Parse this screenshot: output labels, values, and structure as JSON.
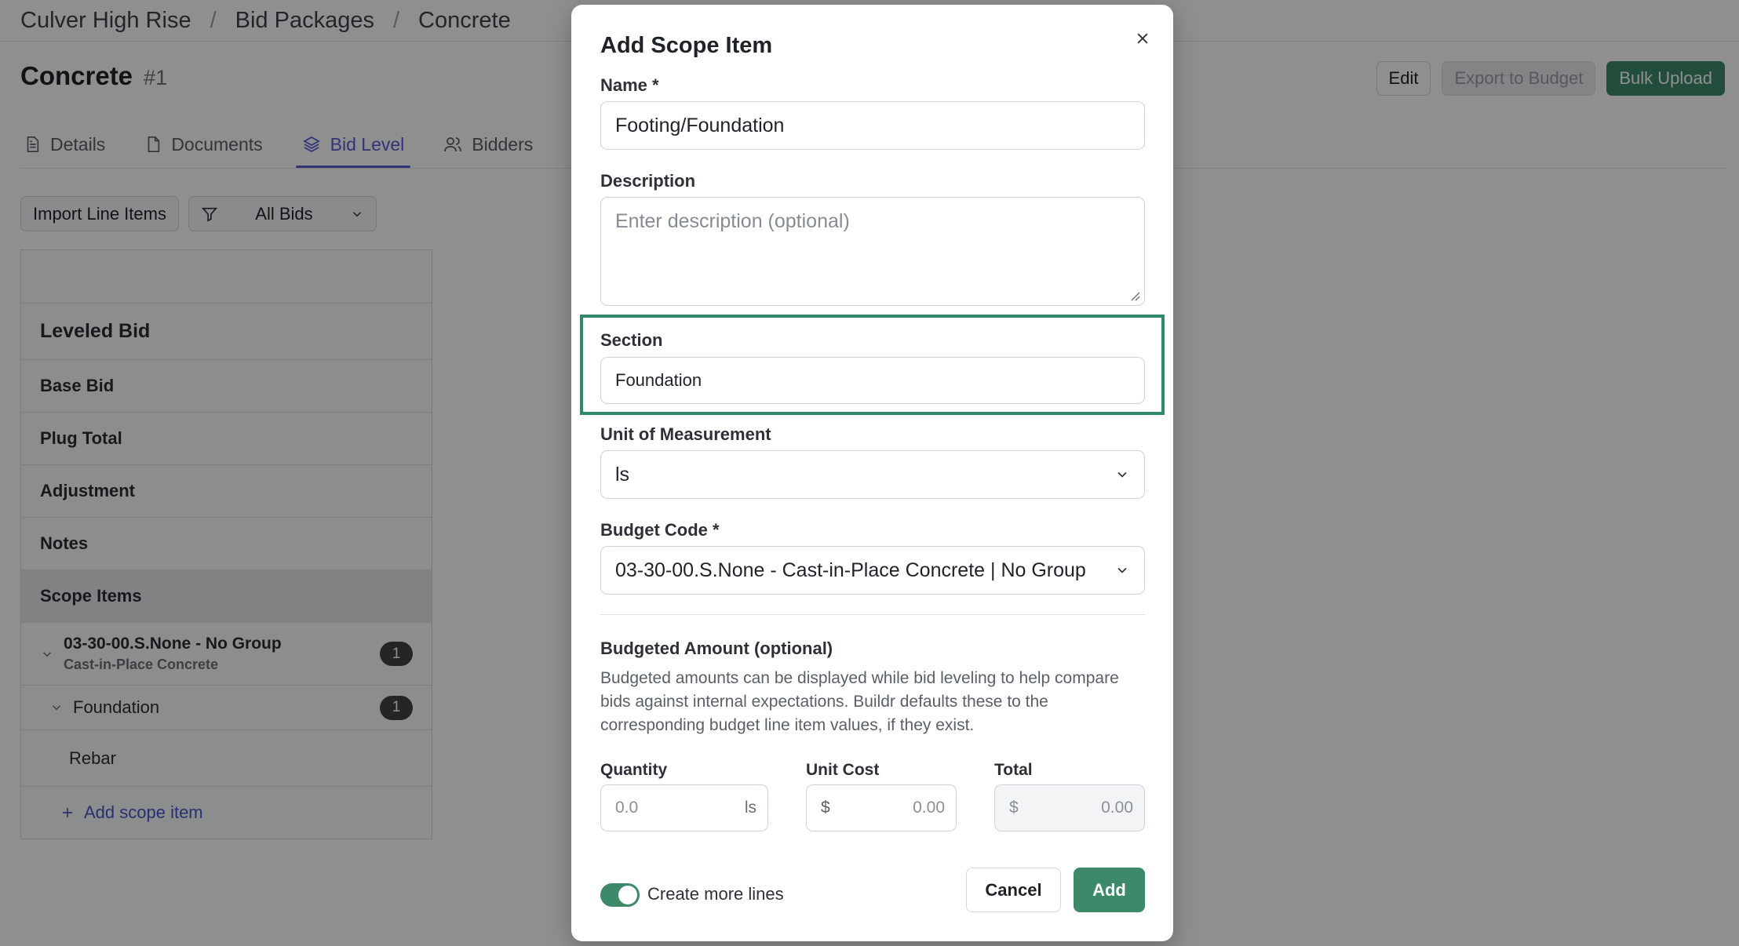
{
  "breadcrumb": {
    "items": [
      "Culver High Rise",
      "Bid Packages",
      "Concrete"
    ],
    "separator": "/"
  },
  "page": {
    "title": "Concrete",
    "number": "#1"
  },
  "actions": {
    "edit": "Edit",
    "export": "Export to Budget",
    "bulk_upload": "Bulk Upload"
  },
  "tabs": [
    {
      "label": "Details",
      "icon": "document-lines-icon"
    },
    {
      "label": "Documents",
      "icon": "document-icon"
    },
    {
      "label": "Bid Level",
      "icon": "layers-icon",
      "active": true
    },
    {
      "label": "Bidders",
      "icon": "users-icon"
    }
  ],
  "toolbar": {
    "import_label": "Import Line Items",
    "filter_value": "All Bids"
  },
  "sidebar": {
    "header": "Leveled Bid",
    "rows": [
      "Base Bid",
      "Plug Total",
      "Adjustment",
      "Notes",
      "Scope Items"
    ],
    "group": {
      "code": "03-30-00.S.None - No Group",
      "name": "Cast-in-Place Concrete",
      "count": "1"
    },
    "subgroup": {
      "label": "Foundation",
      "count": "1"
    },
    "leaf": "Rebar",
    "add_label": "Add scope item"
  },
  "modal": {
    "title": "Add Scope Item",
    "name_label": "Name *",
    "name_value": "Footing/Foundation",
    "description_label": "Description",
    "description_placeholder": "Enter description (optional)",
    "section_label": "Section",
    "section_value": "Foundation",
    "uom_label": "Unit of Measurement",
    "uom_value": "ls",
    "budget_code_label": "Budget Code *",
    "budget_code_value": "03-30-00.S.None - Cast-in-Place Concrete | No Group",
    "budgeted_title": "Budgeted Amount (optional)",
    "budgeted_desc": "Budgeted amounts can be displayed while bid leveling to help compare bids against internal expectations. Buildr defaults these to the corresponding budget line item values, if they exist.",
    "quantity_label": "Quantity",
    "quantity_placeholder": "0.0",
    "quantity_unit": "ls",
    "unit_cost_label": "Unit Cost",
    "unit_cost_prefix": "$",
    "unit_cost_placeholder": "0.00",
    "total_label": "Total",
    "total_prefix": "$",
    "total_value": "0.00",
    "create_more_label": "Create more lines",
    "create_more_on": true,
    "cancel_label": "Cancel",
    "add_label": "Add"
  },
  "colors": {
    "accent_green": "#3d8a6a",
    "tab_active": "#5b5bd6",
    "highlight": "#2f8a69",
    "badge": "#3f4347"
  }
}
